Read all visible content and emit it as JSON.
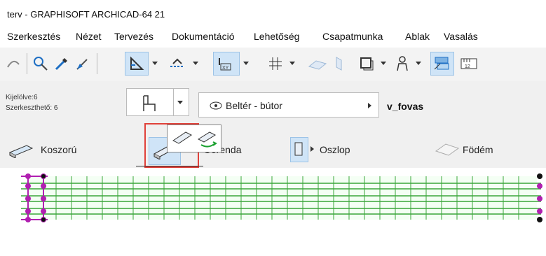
{
  "window": {
    "title": "terv - GRAPHISOFT ARCHICAD-64 21"
  },
  "menu": [
    "Szerkesztés",
    "Nézet",
    "Tervezés",
    "Dokumentáció",
    "Lehetőség",
    "Csapatmunka",
    "Ablak",
    "Vasalás"
  ],
  "toolbar": {
    "icons": [
      "arc-icon",
      "magic-wand-icon",
      "pipette-icon",
      "inject-icon",
      "gravity-icon",
      "snap-icon",
      "xy-icon",
      "grid-icon",
      "plane-icon",
      "shape-icon",
      "window-icon",
      "person-icon",
      "layer-icon",
      "ruler-icon"
    ]
  },
  "info": {
    "selected": "Kijelölve:6",
    "editable": "Szerkeszthető: 6",
    "layer": "Beltér - bútor",
    "layer_icon": "eye-icon",
    "layer_name": "v_fovas"
  },
  "tools": {
    "koszoru": "Koszorú",
    "gerenda": "Gerenda",
    "oszlop": "Oszlop",
    "fodem": "Födém"
  },
  "colors": {
    "accent_blue": "#cfe4f7",
    "highlight_red": "#e0413a",
    "plan_green": "#3aa63a",
    "node_magenta": "#b01fb0"
  }
}
